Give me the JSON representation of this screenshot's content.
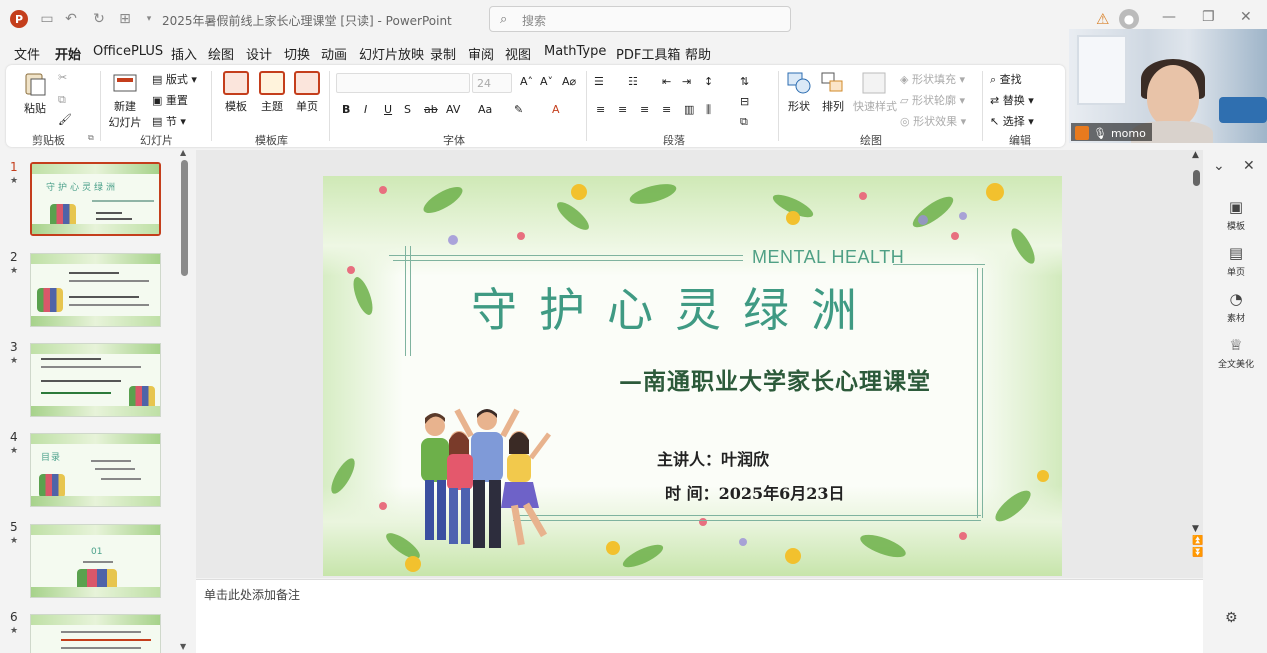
{
  "window": {
    "title": "2025年暑假前线上家长心理课堂 [只读] - PowerPoint",
    "app_logo": "P",
    "search_placeholder": "搜索"
  },
  "menu_tabs": [
    "文件",
    "开始",
    "OfficePLUS",
    "插入",
    "绘图",
    "设计",
    "切换",
    "动画",
    "幻灯片放映",
    "录制",
    "审阅",
    "视图",
    "MathType",
    "PDF工具箱",
    "帮助"
  ],
  "active_tab": "开始",
  "ribbon": {
    "clipboard": {
      "paste": "粘贴",
      "group": "剪贴板"
    },
    "slides": {
      "new_slide": "新建\n幻灯片",
      "new_slide_line1": "新建",
      "new_slide_line2": "幻灯片",
      "layout": "版式",
      "reset": "重置",
      "section": "节",
      "group": "幻灯片"
    },
    "template": {
      "template": "模板",
      "theme": "主题",
      "single_page": "单页",
      "group": "模板库"
    },
    "font": {
      "size": "24",
      "group": "字体"
    },
    "paragraph": {
      "group": "段落"
    },
    "drawing": {
      "shape": "形状",
      "arrange": "排列",
      "quick_style": "快速样式",
      "shape_fill": "形状填充",
      "shape_outline": "形状轮廓",
      "shape_effect": "形状效果",
      "group": "绘图"
    },
    "editing": {
      "find": "查找",
      "replace": "替换",
      "select": "选择",
      "group": "编辑"
    }
  },
  "video": {
    "participant": "momo"
  },
  "thumbnails": [
    {
      "num": "1",
      "selected": true,
      "title": "守护心灵绿洲"
    },
    {
      "num": "2",
      "selected": false
    },
    {
      "num": "3",
      "selected": false
    },
    {
      "num": "4",
      "selected": false,
      "title": "目录"
    },
    {
      "num": "5",
      "selected": false,
      "title": "01"
    },
    {
      "num": "6",
      "selected": false
    }
  ],
  "slide": {
    "tagline": "MENTAL HEALTH",
    "title": "守护心灵绿洲",
    "subtitle": "—南通职业大学家长心理课堂",
    "presenter": "主讲人：叶润欣",
    "date": "时 间：2025年6月23日"
  },
  "notes": {
    "placeholder": "单击此处添加备注"
  },
  "right_pane": [
    {
      "label": "模板",
      "icon": "template-icon"
    },
    {
      "label": "单页",
      "icon": "single-page-icon"
    },
    {
      "label": "素材",
      "icon": "material-icon"
    },
    {
      "label": "全文美化",
      "icon": "beautify-icon"
    }
  ],
  "colors": {
    "accent": "#c43e1c",
    "slide_title": "#3f9a83",
    "subtitle": "#2c5a3a"
  }
}
